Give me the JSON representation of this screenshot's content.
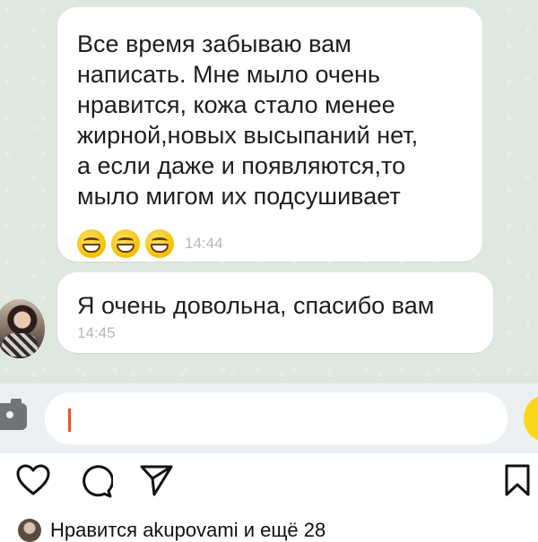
{
  "chat": {
    "messages": [
      {
        "text": "Все время забываю вам\nнаписать. Мне мыло очень\nнравится, кожа стало менее\nжирной,новых высыпаний нет,\nа если даже и появляются,то\nмыло мигом их подсушивает",
        "emojis": [
          "grinning-face-with-smiling-eyes",
          "grinning-face-with-smiling-eyes",
          "grinning-face-with-smiling-eyes"
        ],
        "time": "14:44"
      },
      {
        "text": "Я очень довольна, спасибо вам",
        "time": "14:45"
      }
    ]
  },
  "composer": {
    "value": "",
    "icons": {
      "camera": "camera-icon",
      "send": "send-icon"
    },
    "accent": "#f9d71c",
    "caret_color": "#e2532b"
  },
  "post_actions": {
    "icons": [
      "heart-icon",
      "comment-icon",
      "share-icon",
      "bookmark-icon"
    ]
  },
  "likes": {
    "text": "Нравится akupovami и ещё 28"
  },
  "colors": {
    "chat_background": "#dfe8df",
    "bubble": "#ffffff",
    "timestamp": "#b7b7b7"
  }
}
